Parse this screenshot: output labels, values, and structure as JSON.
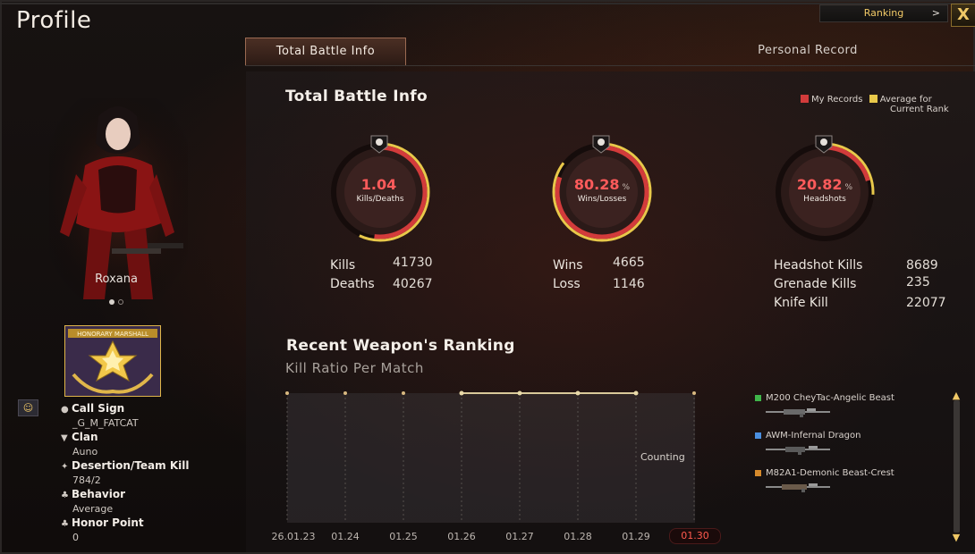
{
  "header": {
    "title": "Profile",
    "ranking_label": "Ranking",
    "ranking_chevron": ">",
    "close_label": "X"
  },
  "tabs": [
    {
      "label": "Total Battle Info",
      "active": true
    },
    {
      "label": "Personal Record",
      "active": false
    }
  ],
  "character": {
    "name": "Roxana",
    "badge_text": "HONORARY MARSHALL"
  },
  "profile_info": [
    {
      "icon": "person-icon",
      "label": "Call Sign",
      "value": "_G_M_FATCAT"
    },
    {
      "icon": "shield-icon",
      "label": "Clan",
      "value": "Auno"
    },
    {
      "icon": "running-icon",
      "label": "Desertion/Team Kill",
      "value": "784/2"
    },
    {
      "icon": "clover-icon",
      "label": "Behavior",
      "value": "Average"
    },
    {
      "icon": "clover-icon",
      "label": "Honor Point",
      "value": "0"
    }
  ],
  "battle": {
    "title": "Total Battle Info",
    "legend_mine": "My Records",
    "legend_avg_line1": "Average for",
    "legend_avg_line2": "Current Rank",
    "colors": {
      "mine": "#d23b3b",
      "avg": "#e8c84a",
      "accent": "#ff5b5b"
    },
    "rings": [
      {
        "icon": "skull-icon",
        "value": "1.04",
        "unit": "",
        "label": "Kills/Deaths",
        "fill": 0.52
      },
      {
        "icon": "crossed-swords-icon",
        "value": "80.28",
        "unit": "%",
        "label": "Wins/Losses",
        "fill": 0.8028
      },
      {
        "icon": "knife-icon",
        "value": "20.82",
        "unit": "%",
        "label": "Headshots",
        "fill": 0.2082
      }
    ],
    "stats_left": [
      {
        "label": "Kills",
        "value": "41730"
      },
      {
        "label": "Deaths",
        "value": "40267"
      }
    ],
    "stats_mid": [
      {
        "label": "Wins",
        "value": "4665"
      },
      {
        "label": "Loss",
        "value": "1146"
      }
    ],
    "stats_right": [
      {
        "label": "Headshot Kills",
        "value": "8689"
      },
      {
        "label": "Grenade Kills",
        "value": "235"
      },
      {
        "label": "Knife Kill",
        "value": "22077"
      }
    ]
  },
  "weapon_ranking": {
    "title": "Recent Weapon's Ranking",
    "subtitle": "Kill Ratio Per Match",
    "counting_label": "Counting",
    "x_labels": [
      "26.01.23",
      "01.24",
      "01.25",
      "01.26",
      "01.27",
      "01.28",
      "01.29",
      "01.30"
    ],
    "selected_index": 7,
    "weapons": [
      {
        "name": "M200 CheyTac-Angelic Beast",
        "color": "#3fb64a"
      },
      {
        "name": "AWM-Infernal Dragon",
        "color": "#4a8fe0"
      },
      {
        "name": "M82A1-Demonic Beast-Crest",
        "color": "#d68a2c"
      }
    ]
  },
  "chart_data": {
    "type": "line",
    "title": "Recent Weapon's Ranking",
    "subtitle": "Kill Ratio Per Match",
    "x": [
      "26.01.23",
      "01.24",
      "01.25",
      "01.26",
      "01.27",
      "01.28",
      "01.29",
      "01.30"
    ],
    "series": [
      {
        "name": "",
        "values": [
          null,
          null,
          null,
          1,
          1,
          1,
          1,
          null
        ]
      }
    ],
    "ylim": [
      0,
      1
    ]
  }
}
